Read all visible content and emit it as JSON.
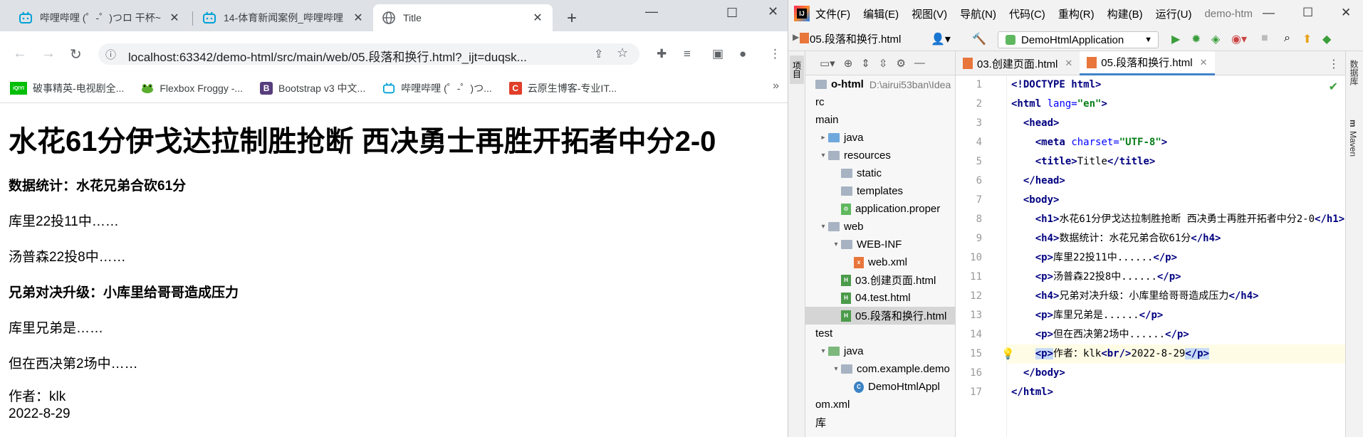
{
  "browser": {
    "tabs": [
      {
        "title": "哔哩哔哩 (゜-゜)つロ 干杯~"
      },
      {
        "title": "14-体育新闻案例_哔哩哔哩"
      },
      {
        "title": "Title"
      }
    ],
    "url": "localhost:63342/demo-html/src/main/web/05.段落和换行.html?_ijt=duqsk...",
    "bookmarks": [
      {
        "label": "破事精英-电视剧全...",
        "icon_text": "iQIYI",
        "color": "#00be06"
      },
      {
        "label": "Flexbox Froggy -...",
        "icon_text": "",
        "color": "#5aad2e"
      },
      {
        "label": "Bootstrap v3 中文...",
        "icon_text": "B",
        "color": "#563d7c"
      },
      {
        "label": "哔哩哔哩 (゜-゜)つ...",
        "icon_text": "",
        "color": "#00a1d6"
      },
      {
        "label": "云原生博客-专业IT...",
        "icon_text": "C",
        "color": "#e03d2a"
      }
    ],
    "page": {
      "h1": "水花61分伊戈达拉制胜抢断 西决勇士再胜开拓者中分2-0",
      "h4_1": "数据统计：水花兄弟合砍61分",
      "p1": "库里22投11中……",
      "p2": "汤普森22投8中……",
      "h4_2": "兄弟对决升级：小库里给哥哥造成压力",
      "p3": "库里兄弟是……",
      "p4": "但在西决第2场中……",
      "p5_line1": "作者：klk",
      "p5_line2": "2022-8-29"
    }
  },
  "ide": {
    "menu": [
      "文件(F)",
      "编辑(E)",
      "视图(V)",
      "导航(N)",
      "代码(C)",
      "重构(R)",
      "构建(B)",
      "运行(U)",
      "demo-htm"
    ],
    "breadcrumb": "05.段落和换行.html",
    "run_config": "DemoHtmlApplication",
    "left_tool": "项目",
    "right_tools": [
      "数据库",
      "Maven"
    ],
    "tree": [
      {
        "label": "o-html",
        "extra": "D:\\airui53ban\\Idea",
        "indent": 0,
        "arrow": "",
        "icon": "folder",
        "bold": true
      },
      {
        "label": "rc",
        "indent": 0,
        "arrow": "",
        "icon": "none"
      },
      {
        "label": "main",
        "indent": 0,
        "arrow": "",
        "icon": "none"
      },
      {
        "label": "java",
        "indent": 1,
        "arrow": "▸",
        "icon": "folder-blue"
      },
      {
        "label": "resources",
        "indent": 1,
        "arrow": "▾",
        "icon": "folder-res"
      },
      {
        "label": "static",
        "indent": 2,
        "arrow": "",
        "icon": "folder"
      },
      {
        "label": "templates",
        "indent": 2,
        "arrow": "",
        "icon": "folder"
      },
      {
        "label": "application.proper",
        "indent": 2,
        "arrow": "",
        "icon": "props"
      },
      {
        "label": "web",
        "indent": 1,
        "arrow": "▾",
        "icon": "folder-web"
      },
      {
        "label": "WEB-INF",
        "indent": 2,
        "arrow": "▾",
        "icon": "folder"
      },
      {
        "label": "web.xml",
        "indent": 3,
        "arrow": "",
        "icon": "xml"
      },
      {
        "label": "03.创建页面.html",
        "indent": 2,
        "arrow": "",
        "icon": "html"
      },
      {
        "label": "04.test.html",
        "indent": 2,
        "arrow": "",
        "icon": "html"
      },
      {
        "label": "05.段落和换行.html",
        "indent": 2,
        "arrow": "",
        "icon": "html",
        "selected": true
      },
      {
        "label": "test",
        "indent": 0,
        "arrow": "",
        "icon": "none"
      },
      {
        "label": "java",
        "indent": 1,
        "arrow": "▾",
        "icon": "folder-green"
      },
      {
        "label": "com.example.demo",
        "indent": 2,
        "arrow": "▾",
        "icon": "folder"
      },
      {
        "label": "DemoHtmlAppl",
        "indent": 3,
        "arrow": "",
        "icon": "class"
      },
      {
        "label": "om.xml",
        "indent": 0,
        "arrow": "",
        "icon": "none"
      },
      {
        "label": "库",
        "indent": 0,
        "arrow": "",
        "icon": "none"
      }
    ],
    "editor_tabs": [
      {
        "label": "03.创建页面.html",
        "active": false
      },
      {
        "label": "05.段落和换行.html",
        "active": true
      }
    ],
    "code_lines": [
      {
        "n": "1",
        "html": "<span class='tag'>&lt;!DOCTYPE html&gt;</span>"
      },
      {
        "n": "2",
        "html": "<span class='tag'>&lt;html</span> <span class='atn'>lang=</span><span class='atv'>\"en\"</span><span class='tag'>&gt;</span>"
      },
      {
        "n": "3",
        "html": "  <span class='tag'>&lt;head&gt;</span>"
      },
      {
        "n": "4",
        "html": "    <span class='tag'>&lt;meta</span> <span class='atn'>charset=</span><span class='atv'>\"UTF-8\"</span><span class='tag'>&gt;</span>"
      },
      {
        "n": "5",
        "html": "    <span class='tag'>&lt;title&gt;</span>Title<span class='tag'>&lt;/title&gt;</span>"
      },
      {
        "n": "6",
        "html": "  <span class='tag'>&lt;/head&gt;</span>"
      },
      {
        "n": "7",
        "html": "  <span class='tag'>&lt;body&gt;</span>"
      },
      {
        "n": "8",
        "html": "    <span class='tag'>&lt;h1&gt;</span>水花61分伊戈达拉制胜抢断 西决勇士再胜开拓者中分2-0<span class='tag'>&lt;/h1&gt;</span>"
      },
      {
        "n": "9",
        "html": "    <span class='tag'>&lt;h4&gt;</span>数据统计：水花兄弟合砍61分<span class='tag'>&lt;/h4&gt;</span>"
      },
      {
        "n": "10",
        "html": "    <span class='tag'>&lt;p&gt;</span>库里22投11中......<span class='tag'>&lt;/p&gt;</span>"
      },
      {
        "n": "11",
        "html": "    <span class='tag'>&lt;p&gt;</span>汤普森22投8中......<span class='tag'>&lt;/p&gt;</span>"
      },
      {
        "n": "12",
        "html": "    <span class='tag'>&lt;h4&gt;</span>兄弟对决升级：小库里给哥哥造成压力<span class='tag'>&lt;/h4&gt;</span>"
      },
      {
        "n": "13",
        "html": "    <span class='tag'>&lt;p&gt;</span>库里兄弟是......<span class='tag'>&lt;/p&gt;</span>"
      },
      {
        "n": "14",
        "html": "    <span class='tag'>&lt;p&gt;</span>但在西决第2场中......<span class='tag'>&lt;/p&gt;</span>"
      },
      {
        "n": "15",
        "html": "    <span class='tag hl'>&lt;p&gt;</span>作者：klk<span class='tag'>&lt;br/&gt;</span>2022-8-29<span class='tag hl'>&lt;/p&gt;</span>",
        "current": true
      },
      {
        "n": "16",
        "html": "  <span class='tag'>&lt;/body&gt;</span>"
      },
      {
        "n": "17",
        "html": "<span class='tag'>&lt;/html&gt;</span>"
      }
    ]
  }
}
